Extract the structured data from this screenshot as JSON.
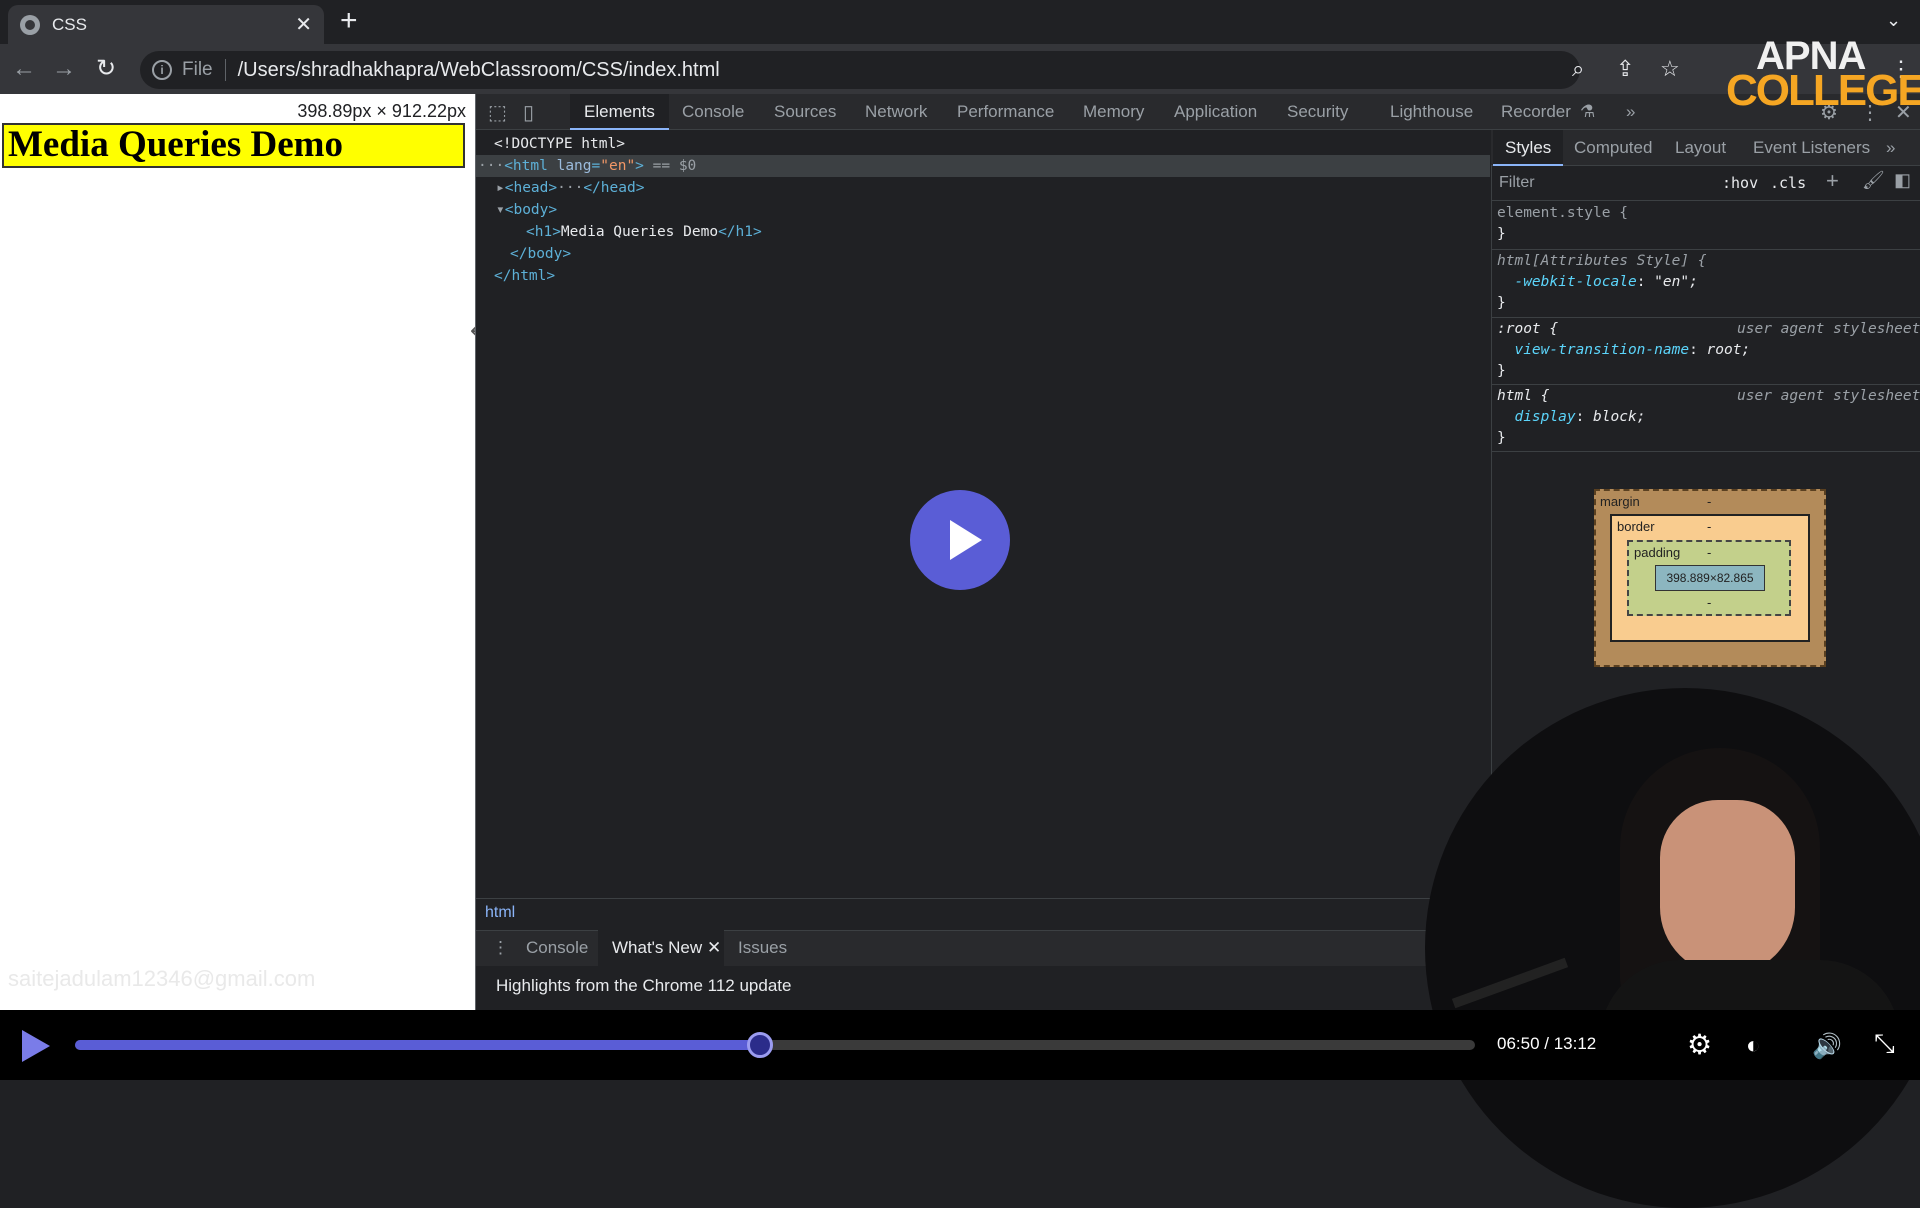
{
  "browser": {
    "tab_title": "CSS",
    "url_scheme": "File",
    "url": "/Users/shradhakhapra/WebClassroom/CSS/index.html"
  },
  "page": {
    "dimensions": "398.89px × 912.22px",
    "heading": "Media Queries Demo",
    "watermark": "saitejadulam12346@gmail.com"
  },
  "devtools": {
    "tabs": [
      "Elements",
      "Console",
      "Sources",
      "Network",
      "Performance",
      "Memory",
      "Application",
      "Security",
      "Lighthouse",
      "Recorder"
    ],
    "tree": {
      "doctype": "<!DOCTYPE html>",
      "html_open": "<html",
      "lang_attr": "lang",
      "lang_val": "\"en\"",
      "html_close_bracket": ">",
      "selected_marker": "== $0",
      "head_open": "<head>",
      "ellipsis": "···",
      "head_close": "</head>",
      "body_open": "<body>",
      "h1_open": "<h1>",
      "h1_text": "Media Queries Demo",
      "h1_close": "</h1>",
      "body_close": "</body>",
      "html_close": "</html>"
    },
    "styles_tabs": [
      "Styles",
      "Computed",
      "Layout",
      "Event Listeners"
    ],
    "filter_placeholder": "Filter",
    "hov": ":hov",
    "cls": ".cls",
    "rules": {
      "r1_selector": "element.style {",
      "r2_selector": "html[Attributes Style] {",
      "r2_prop": "-webkit-locale",
      "r2_val": "\"en\";",
      "r3_selector": ":root {",
      "r3_prop": "view-transition-name",
      "r3_val": "root;",
      "r4_selector": "html {",
      "r4_prop": "display",
      "r4_val": "block;",
      "ua": "user agent stylesheet",
      "close": "}"
    },
    "box_model": {
      "margin": "margin",
      "border": "border",
      "padding": "padding",
      "content": "398.889×82.865",
      "dash": "-"
    },
    "breadcrumb": "html",
    "drawer_tabs": [
      "Console",
      "What's New",
      "Issues"
    ],
    "drawer_text": "Highlights from the Chrome 112 update"
  },
  "overlay": {
    "logo_top": "APNA",
    "logo_bottom": "COLLEGE"
  },
  "player": {
    "time": "06:50 / 13:12",
    "progress": 0.49
  }
}
